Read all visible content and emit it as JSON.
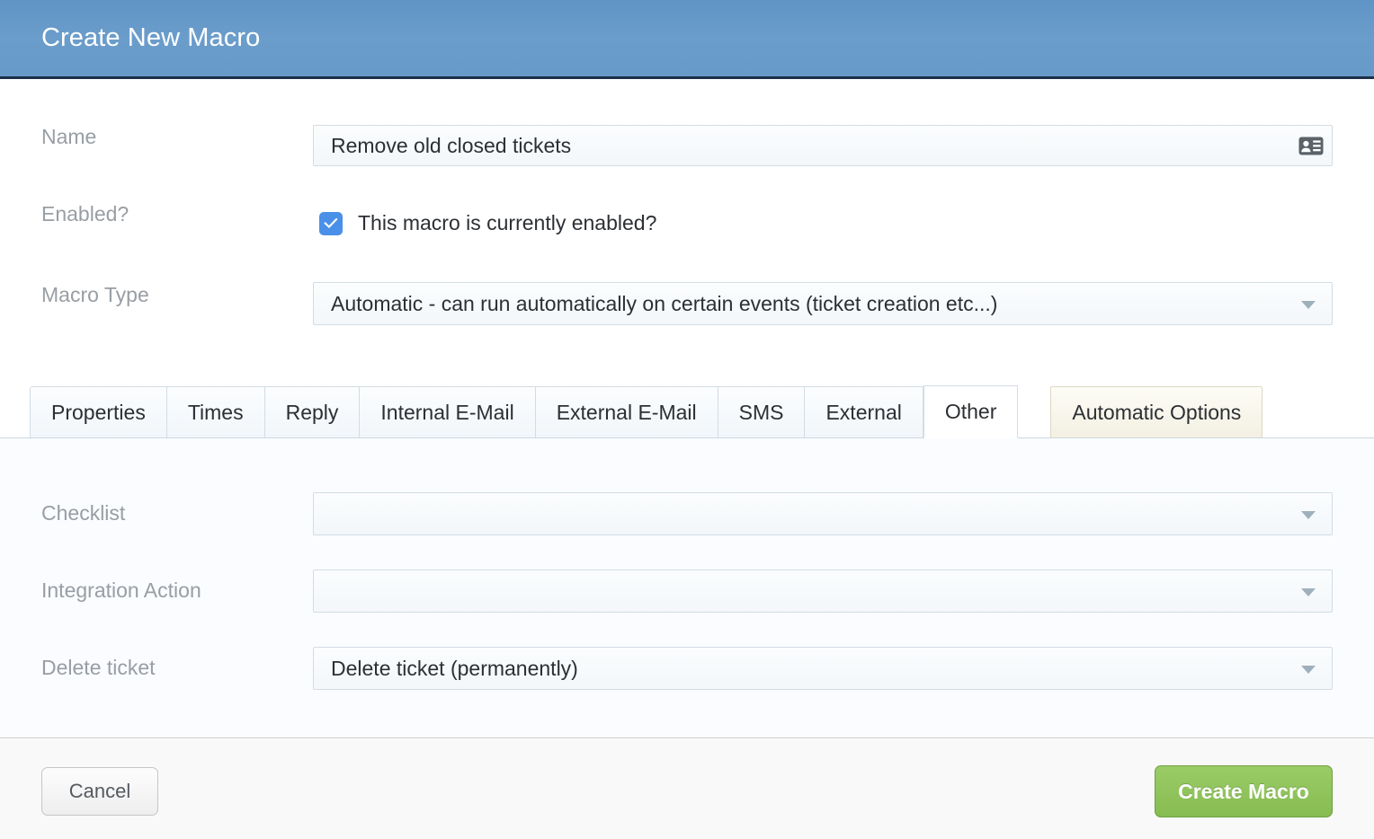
{
  "dialog": {
    "title": "Create New Macro",
    "header_color": "#679ac9",
    "header_border_color": "#1d3049"
  },
  "form": {
    "name": {
      "label": "Name",
      "value": "Remove old closed tickets",
      "placeholder": "",
      "icon": "vcard-icon"
    },
    "enabled": {
      "label": "Enabled?",
      "checkbox_label": "This macro is currently enabled?",
      "checked": true,
      "checkbox_color": "#4a90e8"
    },
    "macro_type": {
      "label": "Macro Type",
      "value": "Automatic - can run automatically on certain events (ticket creation etc...)",
      "arrow_icon": "chevron-down-icon"
    }
  },
  "tabs": {
    "items": [
      {
        "label": "Properties",
        "active": false,
        "style": "normal"
      },
      {
        "label": "Times",
        "active": false,
        "style": "normal"
      },
      {
        "label": "Reply",
        "active": false,
        "style": "normal"
      },
      {
        "label": "Internal E-Mail",
        "active": false,
        "style": "normal"
      },
      {
        "label": "External E-Mail",
        "active": false,
        "style": "normal"
      },
      {
        "label": "SMS",
        "active": false,
        "style": "normal"
      },
      {
        "label": "External",
        "active": false,
        "style": "normal"
      },
      {
        "label": "Other",
        "active": true,
        "style": "normal"
      },
      {
        "label": "Automatic Options",
        "active": false,
        "style": "special"
      }
    ]
  },
  "panel": {
    "checklist": {
      "label": "Checklist",
      "value": "",
      "arrow_icon": "chevron-down-icon"
    },
    "integration_action": {
      "label": "Integration Action",
      "value": "",
      "arrow_icon": "chevron-down-icon"
    },
    "delete_ticket": {
      "label": "Delete ticket",
      "value": "Delete ticket (permanently)",
      "arrow_icon": "chevron-down-icon"
    }
  },
  "footer": {
    "cancel_label": "Cancel",
    "create_label": "Create Macro",
    "create_color": "#8cbf58"
  }
}
